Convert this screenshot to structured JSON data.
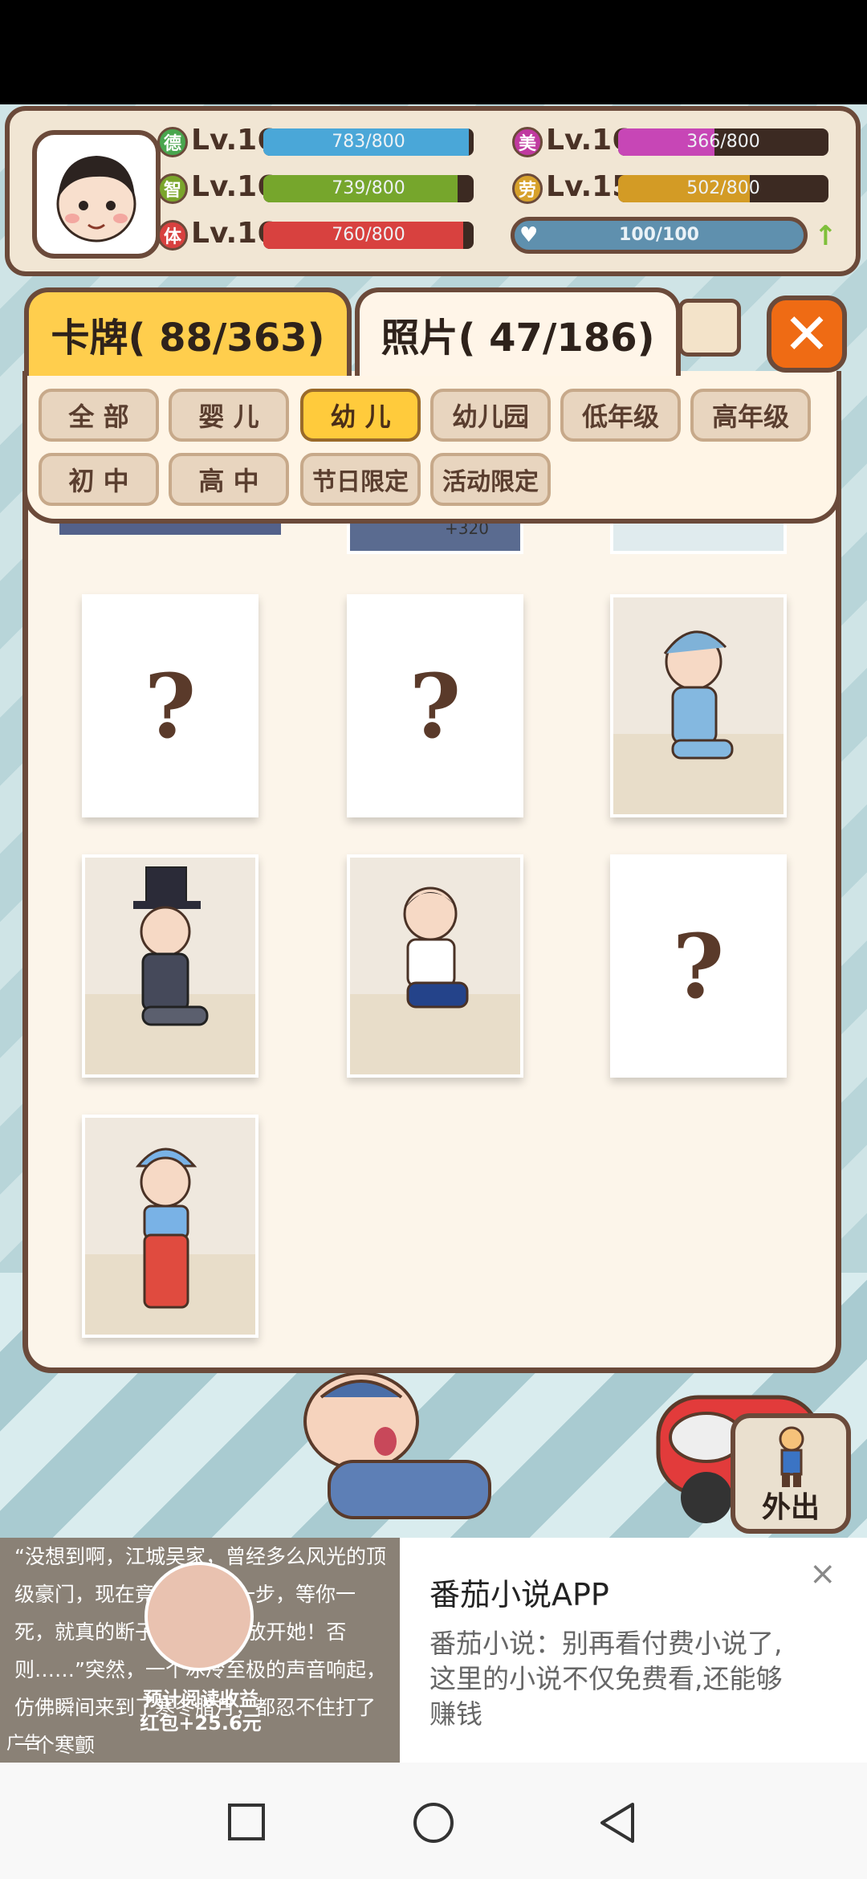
{
  "header": {
    "stats": [
      {
        "icon": "德",
        "icon_color": "#49a64e",
        "level": "Lv.16",
        "value": "783/800",
        "fill": 0.979,
        "bar_color": "#4aa7d8"
      },
      {
        "icon": "智",
        "icon_color": "#7aa52b",
        "level": "Lv.16",
        "value": "739/800",
        "fill": 0.924,
        "bar_color": "#76a62c"
      },
      {
        "icon": "体",
        "icon_color": "#d8413f",
        "level": "Lv.16",
        "value": "760/800",
        "fill": 0.95,
        "bar_color": "#d8413f"
      },
      {
        "icon": "美",
        "icon_color": "#c03aa0",
        "level": "Lv.16",
        "value": "366/800",
        "fill": 0.4575,
        "bar_color": "#c746b6"
      },
      {
        "icon": "劳",
        "icon_color": "#d7a12b",
        "level": "Lv.15",
        "value": "502/800",
        "fill": 0.6275,
        "bar_color": "#d39b25"
      }
    ],
    "stamina": {
      "value": "100/100",
      "fill": 1.0
    }
  },
  "tabs": {
    "cards": "卡牌( 88/363)",
    "photos": "照片( 47/186)"
  },
  "filters": {
    "row1": [
      "全 部",
      "婴 儿",
      "幼 儿",
      "幼儿园",
      "低年级",
      "高年级"
    ],
    "row2": [
      "初 中",
      "高 中",
      "节日限定",
      "活动限定"
    ],
    "active": "幼 儿"
  },
  "partial_row": {
    "badge1": "+320"
  },
  "cards": [
    {
      "type": "unknown",
      "symbol": "?"
    },
    {
      "type": "unknown",
      "symbol": "?"
    },
    {
      "type": "photo",
      "outfit": "blue-pajamas-nightcap"
    },
    {
      "type": "photo",
      "outfit": "tuxedo-top-hat"
    },
    {
      "type": "photo",
      "outfit": "sailor-uniform"
    },
    {
      "type": "unknown",
      "symbol": "?"
    },
    {
      "type": "photo",
      "outfit": "red-overalls-cap"
    }
  ],
  "go_out_button": "外出",
  "ad": {
    "story": "“没想到啊，江城吴家，曾经多么风光的顶级豪门，现在竟然落到这一步，等你一死，就真的断子绝孙了。”“放开她！否则……”突然，一个冰冷至极的声音响起，仿佛瞬间来到了寒冬腊月，都忍不住打了一个寒颤",
    "label": "广告",
    "reward_line1": "预计阅读收益",
    "reward_line2": "红包+25.6元",
    "title": "番茄小说APP",
    "description": "番茄小说：别再看付费小说了,这里的小说不仅免费看,还能够赚钱",
    "close": "×"
  }
}
